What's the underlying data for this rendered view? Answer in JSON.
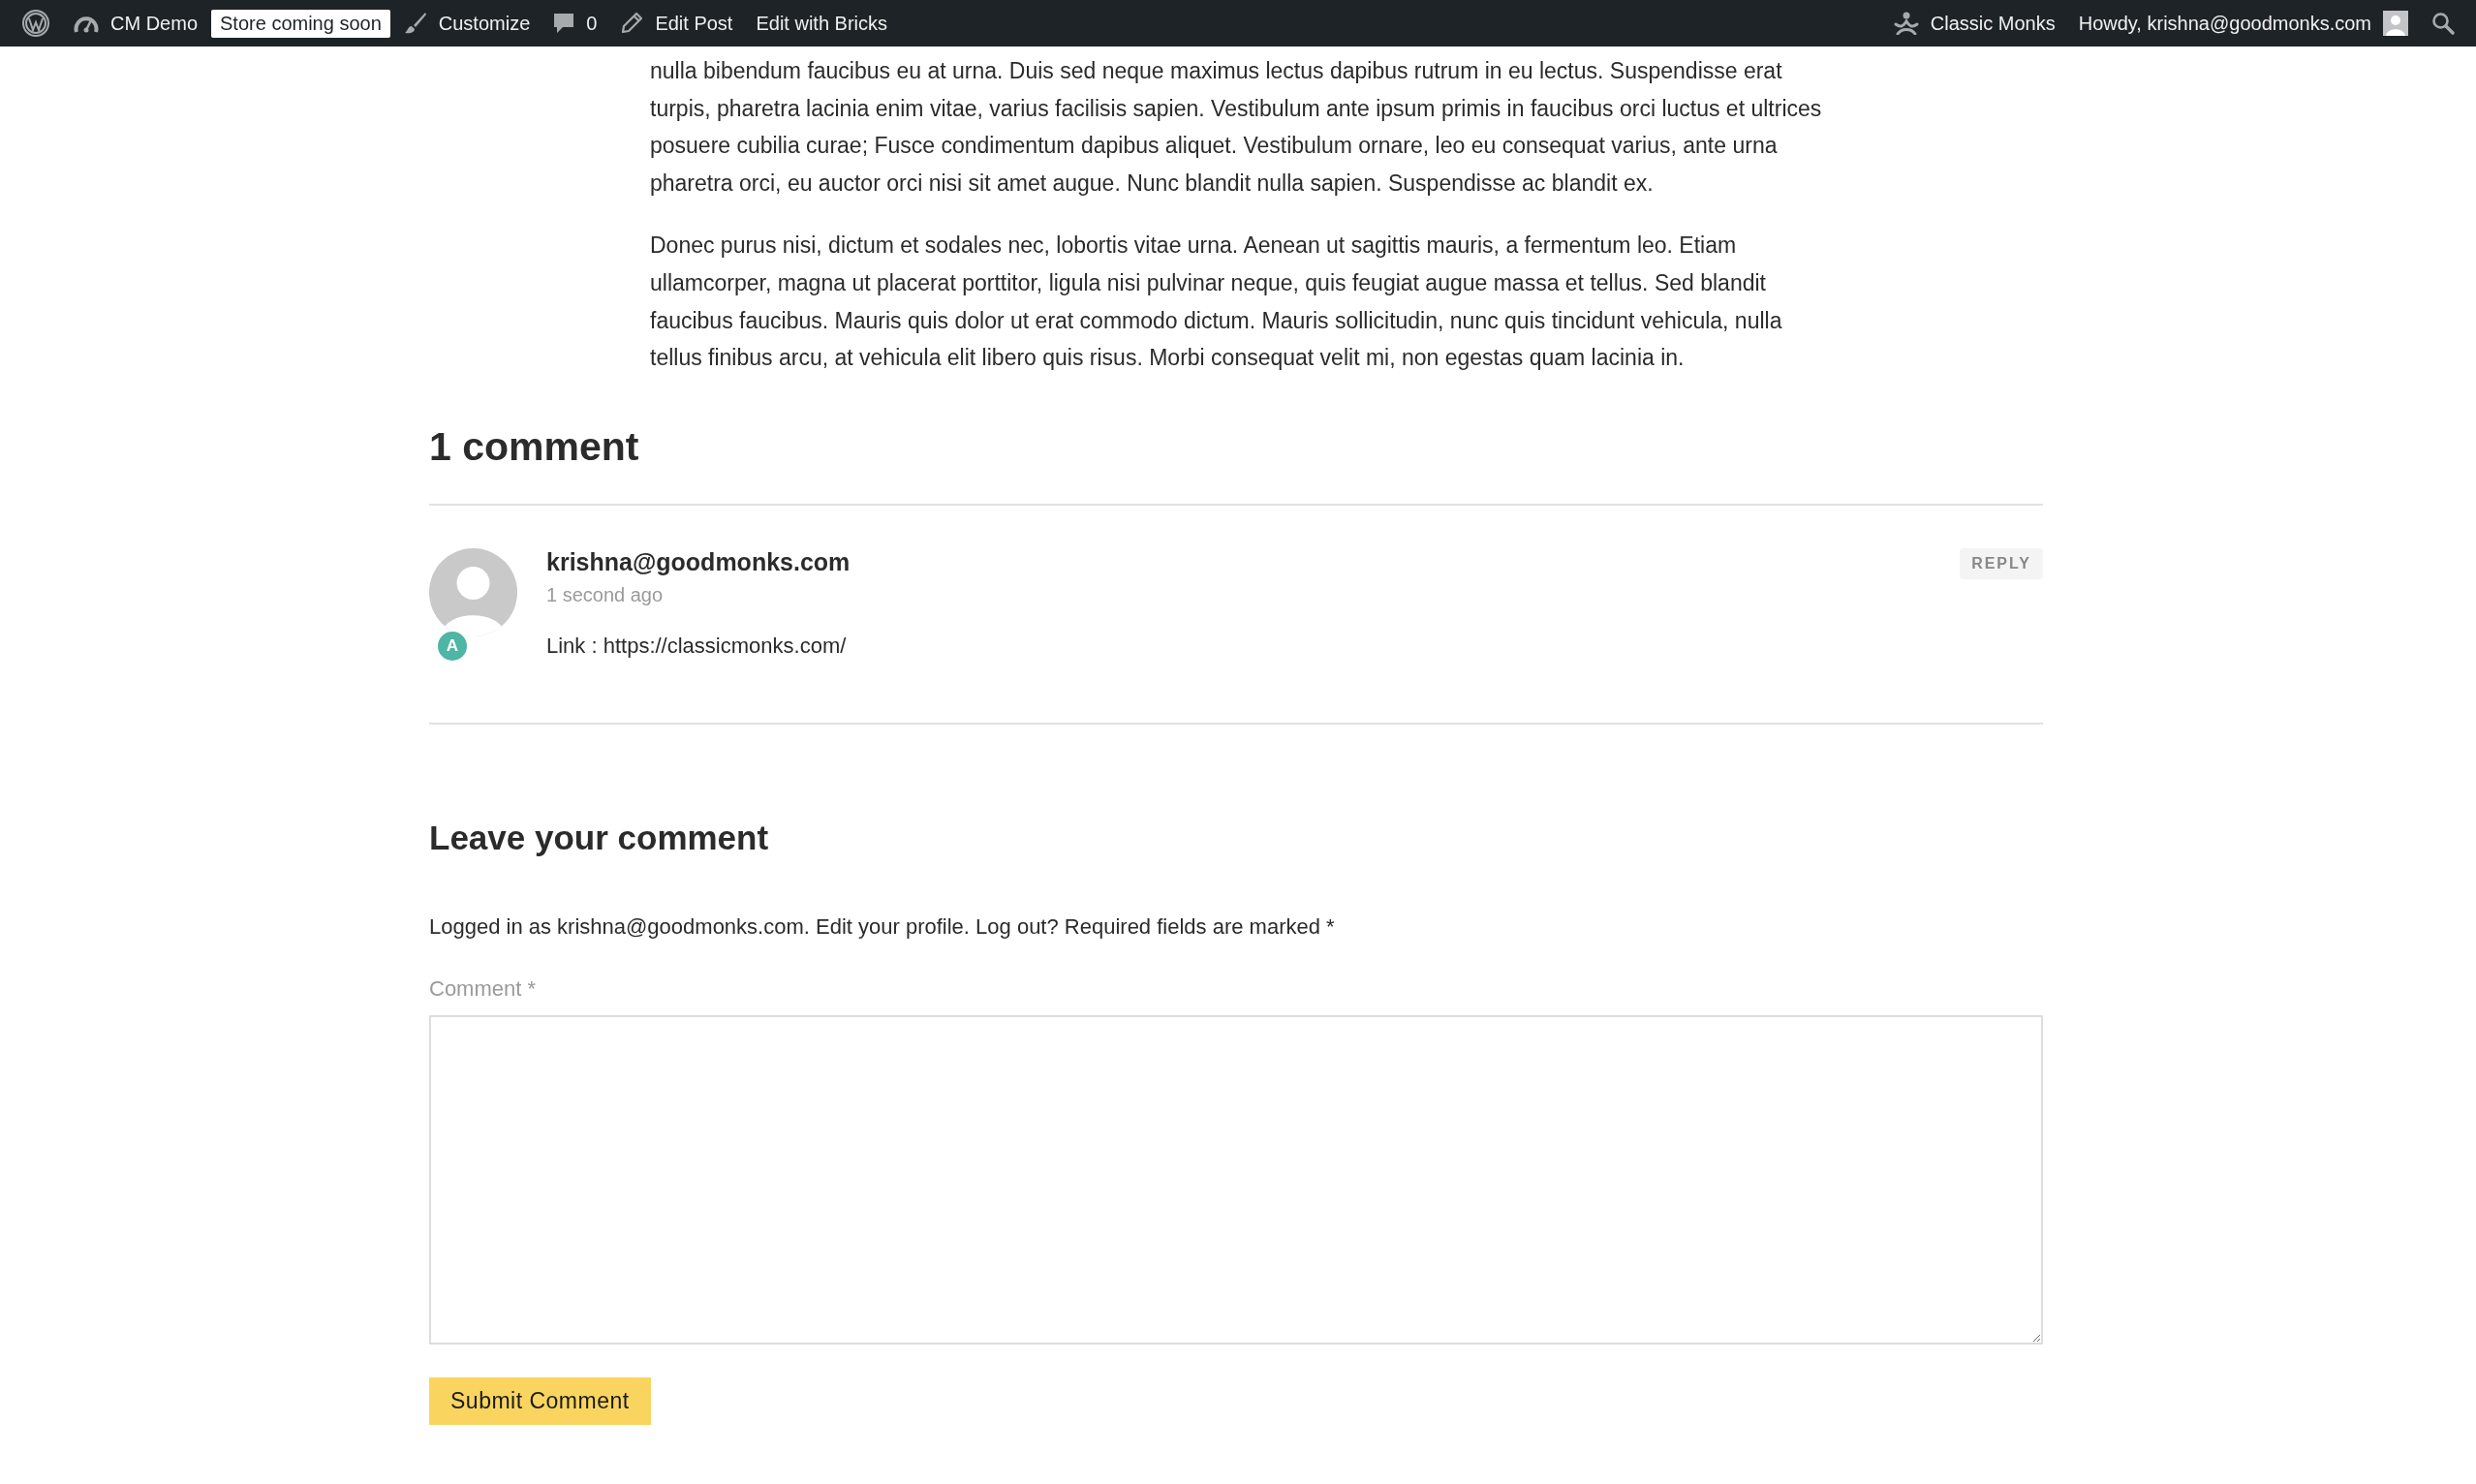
{
  "admin_bar": {
    "left": [
      {
        "kind": "logo"
      },
      {
        "kind": "site",
        "label": "CM Demo"
      },
      {
        "kind": "badge",
        "label": "Store coming soon"
      },
      {
        "kind": "customize",
        "label": "Customize"
      },
      {
        "kind": "comments",
        "label": "0"
      },
      {
        "kind": "edit",
        "label": "Edit Post"
      },
      {
        "kind": "text",
        "label": "Edit with Bricks"
      }
    ],
    "right": [
      {
        "kind": "brand",
        "label": "Classic Monks"
      },
      {
        "kind": "account",
        "label": "Howdy, krishna@goodmonks.com"
      },
      {
        "kind": "search"
      }
    ]
  },
  "article": {
    "paragraphs": [
      "nulla bibendum faucibus eu at urna. Duis sed neque maximus lectus dapibus rutrum in eu lectus. Suspendisse erat turpis, pharetra lacinia enim vitae, varius facilisis sapien. Vestibulum ante ipsum primis in faucibus orci luctus et ultrices posuere cubilia curae; Fusce condimentum dapibus aliquet. Vestibulum ornare, leo eu consequat varius, ante urna pharetra orci, eu auctor orci nisi sit amet augue. Nunc blandit nulla sapien. Suspendisse ac blandit ex.",
      "Donec purus nisi, dictum et sodales nec, lobortis vitae urna. Aenean ut sagittis mauris, a fermentum leo. Etiam ullamcorper, magna ut placerat porttitor, ligula nisi pulvinar neque, quis feugiat augue massa et tellus. Sed blandit faucibus faucibus. Mauris quis dolor ut erat commodo dictum. Mauris sollicitudin, nunc quis tincidunt vehicula, nulla tellus finibus arcu, at vehicula elit libero quis risus. Morbi consequat velit mi, non egestas quam lacinia in."
    ]
  },
  "comments": {
    "title": "1 comment",
    "items": [
      {
        "author": "krishna@goodmonks.com",
        "time": "1 second ago",
        "role_badge": "A",
        "text": "Link : https://classicmonks.com/",
        "reply": "REPLY"
      }
    ]
  },
  "comment_form": {
    "title": "Leave your comment",
    "logged_in_note": "Logged in as krishna@goodmonks.com. Edit your profile. Log out? Required fields are marked *",
    "comment_label": "Comment *",
    "submit": "Submit Comment"
  }
}
